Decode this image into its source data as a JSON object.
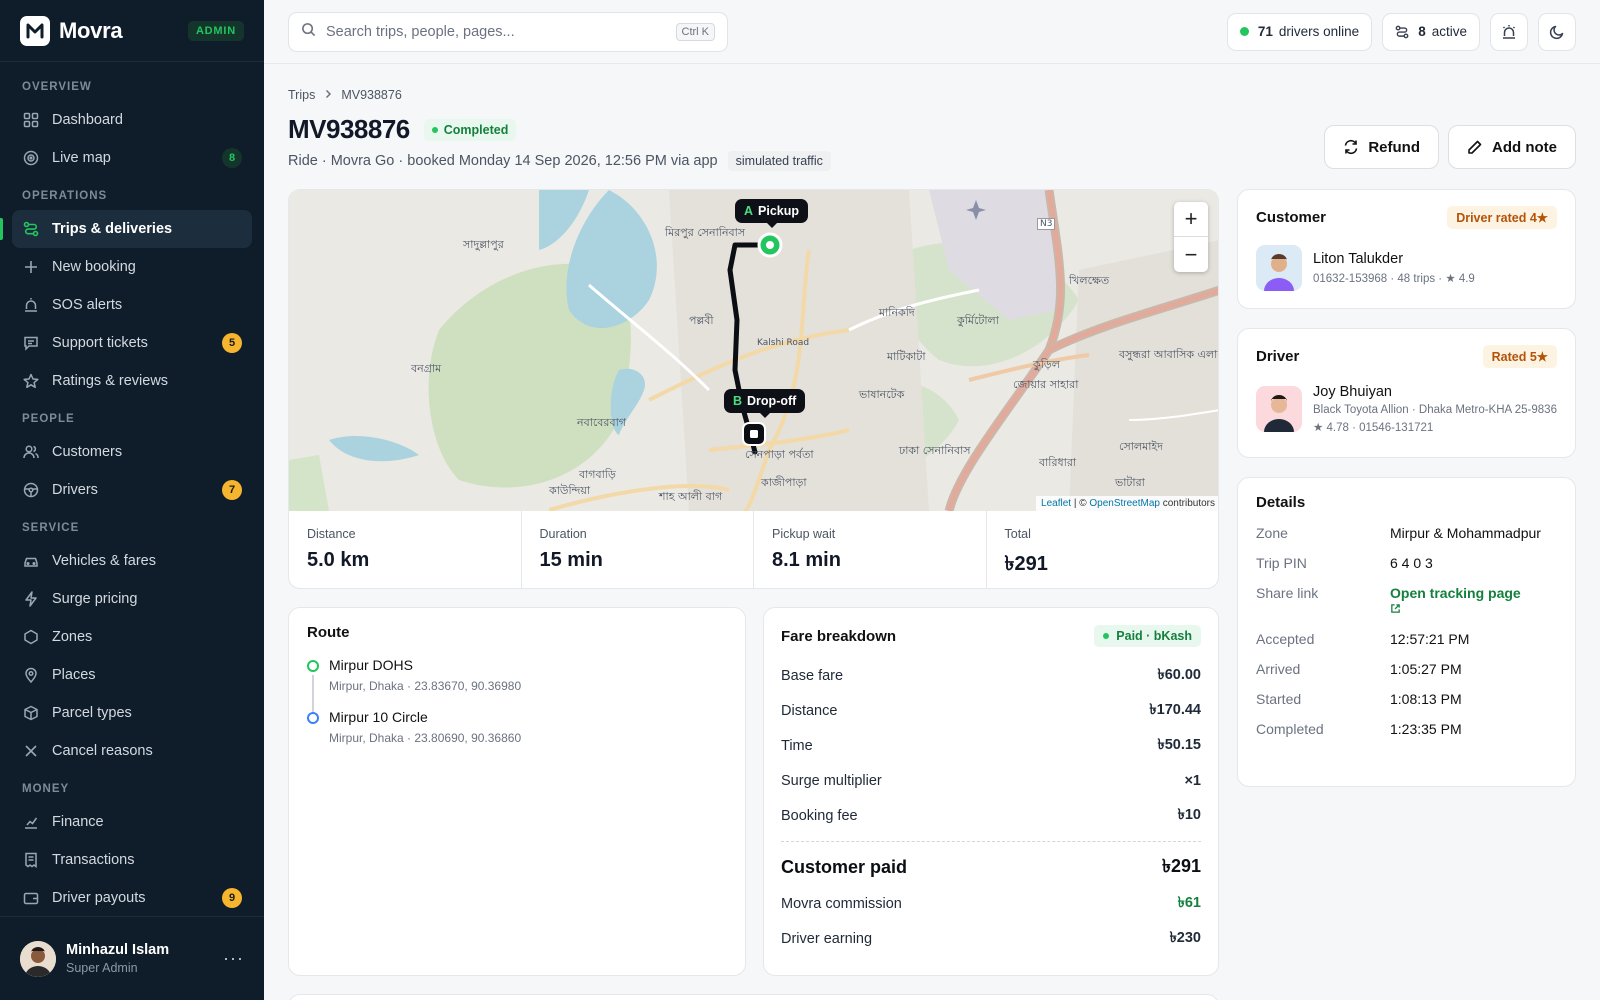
{
  "brand": {
    "name": "Movra",
    "badge": "ADMIN"
  },
  "sidebar": {
    "sections": [
      {
        "title": "OVERVIEW",
        "items": [
          {
            "label": "Dashboard",
            "icon": "grid-icon"
          },
          {
            "label": "Live map",
            "icon": "radar-icon",
            "badge": "8",
            "badge_color": "green"
          }
        ]
      },
      {
        "title": "OPERATIONS",
        "items": [
          {
            "label": "Trips & deliveries",
            "icon": "route-icon",
            "active": true
          },
          {
            "label": "New booking",
            "icon": "plus-icon"
          },
          {
            "label": "SOS alerts",
            "icon": "siren-icon"
          },
          {
            "label": "Support tickets",
            "icon": "message-icon",
            "badge": "5",
            "badge_color": "amber"
          },
          {
            "label": "Ratings & reviews",
            "icon": "star-icon"
          }
        ]
      },
      {
        "title": "PEOPLE",
        "items": [
          {
            "label": "Customers",
            "icon": "users-icon"
          },
          {
            "label": "Drivers",
            "icon": "steering-wheel-icon",
            "badge": "7",
            "badge_color": "amber"
          }
        ]
      },
      {
        "title": "SERVICE",
        "items": [
          {
            "label": "Vehicles & fares",
            "icon": "car-icon"
          },
          {
            "label": "Surge pricing",
            "icon": "bolt-icon"
          },
          {
            "label": "Zones",
            "icon": "hexagon-icon"
          },
          {
            "label": "Places",
            "icon": "pin-icon"
          },
          {
            "label": "Parcel types",
            "icon": "package-icon"
          },
          {
            "label": "Cancel reasons",
            "icon": "x-icon"
          }
        ]
      },
      {
        "title": "MONEY",
        "items": [
          {
            "label": "Finance",
            "icon": "chart-icon"
          },
          {
            "label": "Transactions",
            "icon": "receipt-icon"
          },
          {
            "label": "Driver payouts",
            "icon": "wallet-icon",
            "badge": "9",
            "badge_color": "amber"
          }
        ]
      }
    ],
    "user": {
      "name": "Minhazul Islam",
      "role": "Super Admin",
      "more": "···"
    }
  },
  "topbar": {
    "search_placeholder": "Search trips, people, pages...",
    "shortcut": "Ctrl K",
    "drivers_online_count": "71",
    "drivers_online_label": "drivers online",
    "active_count": "8",
    "active_label": "active"
  },
  "breadcrumb": {
    "parent": "Trips",
    "current": "MV938876"
  },
  "trip": {
    "id": "MV938876",
    "status": "Completed",
    "subtitle": "Ride · Movra Go · booked Monday 14 Sep 2026, 12:56 PM via app",
    "tag": "simulated traffic"
  },
  "actions": {
    "refund": "Refund",
    "add_note": "Add note"
  },
  "map": {
    "pickup_letter": "A",
    "pickup_label": "Pickup",
    "dropoff_letter": "B",
    "dropoff_label": "Drop-off",
    "zoom_in": "+",
    "zoom_out": "−",
    "attribution_leaflet": "Leaflet",
    "attribution_sep": " | © ",
    "attribution_osm": "OpenStreetMap",
    "attribution_rest": " contributors",
    "places": [
      "মিরপুর সেনানিবাস",
      "সাদুল্লাপুর",
      "পল্লবী",
      "মানিকদি",
      "কুর্মিটোলা",
      "খিলক্ষেত",
      "মাটিকাটা",
      "বনগ্রাম",
      "ভাষানটেক",
      "জোয়ার সাহারা",
      "কুড়িল",
      "বসুন্ধরা আবাসিক এলাকা",
      "নবাবেরবাগ",
      "সেনপাড়া পর্বতা",
      "ঢাকা সেনানিবাস",
      "সোলমাইদ",
      "বারিধারা",
      "বাগবাড়ি",
      "কাজীপাড়া",
      "শাহ আলী বাগ",
      "ভাটারা",
      "কাউন্দিয়া",
      "Kalshi Road",
      "N3"
    ]
  },
  "stats": [
    {
      "label": "Distance",
      "value": "5.0 km"
    },
    {
      "label": "Duration",
      "value": "15 min"
    },
    {
      "label": "Pickup wait",
      "value": "8.1 min"
    },
    {
      "label": "Total",
      "value": "৳291"
    }
  ],
  "route": {
    "title": "Route",
    "stops": [
      {
        "name": "Mirpur DOHS",
        "address": "Mirpur, Dhaka · 23.83670, 90.36980"
      },
      {
        "name": "Mirpur 10 Circle",
        "address": "Mirpur, Dhaka · 23.80690, 90.36860"
      }
    ]
  },
  "fare": {
    "title": "Fare breakdown",
    "payment": "Paid · bKash",
    "rows": [
      {
        "label": "Base fare",
        "value": "৳60.00"
      },
      {
        "label": "Distance",
        "value": "৳170.44"
      },
      {
        "label": "Time",
        "value": "৳50.15"
      },
      {
        "label": "Surge multiplier",
        "value": "×1"
      },
      {
        "label": "Booking fee",
        "value": "৳10"
      }
    ],
    "customer_paid_label": "Customer paid",
    "customer_paid": "৳291",
    "commission_label": "Movra commission",
    "commission": "৳61",
    "driver_earning_label": "Driver earning",
    "driver_earning": "৳230"
  },
  "customer": {
    "title": "Customer",
    "badge": "Driver rated 4★",
    "name": "Liton Talukder",
    "meta": "01632-153968 · 48 trips · ★ 4.9"
  },
  "driver": {
    "title": "Driver",
    "badge": "Rated 5★",
    "name": "Joy Bhuiyan",
    "vehicle": "Black Toyota Allion · Dhaka Metro-KHA 25-9836",
    "meta": "★ 4.78 · 01546-131721"
  },
  "details": {
    "title": "Details",
    "zone_label": "Zone",
    "zone": "Mirpur & Mohammadpur",
    "pin_label": "Trip PIN",
    "pin": "6 4 0 3",
    "share_label": "Share link",
    "share": "Open tracking page",
    "accepted_label": "Accepted",
    "accepted": "12:57:21 PM",
    "arrived_label": "Arrived",
    "arrived": "1:05:27 PM",
    "started_label": "Started",
    "started": "1:08:13 PM",
    "completed_label": "Completed",
    "completed": "1:23:35 PM"
  },
  "colors": {
    "accent": "#22c55e",
    "sidebar_bg": "#0f1d2a",
    "amber": "#f5b52e"
  }
}
